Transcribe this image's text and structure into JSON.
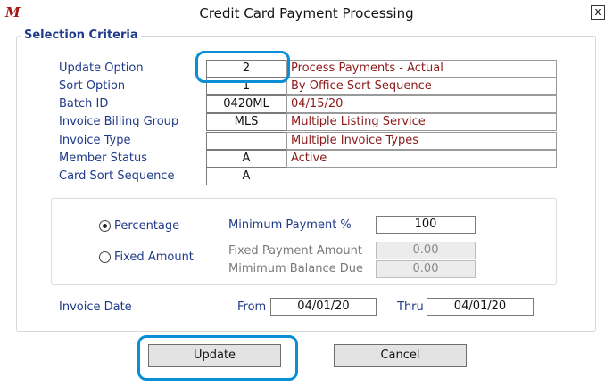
{
  "window": {
    "title": "Credit Card Payment Processing",
    "close_glyph": "x",
    "app_icon_glyph": "M"
  },
  "selection": {
    "title": "Selection Criteria",
    "update_option": {
      "label": "Update Option",
      "value": "2",
      "desc": "Process Payments - Actual"
    },
    "sort_option": {
      "label": "Sort Option",
      "value": "1",
      "desc": "By Office Sort Sequence"
    },
    "batch_id": {
      "label": "Batch ID",
      "value": "0420ML",
      "desc": "04/15/20"
    },
    "billing_group": {
      "label": "Invoice Billing Group",
      "value": "MLS",
      "desc": "Multiple Listing Service"
    },
    "invoice_type": {
      "label": "Invoice Type",
      "value": "",
      "desc": "Multiple Invoice Types"
    },
    "member_status": {
      "label": "Member Status",
      "value": "A",
      "desc": "Active"
    },
    "card_sort": {
      "label": "Card Sort Sequence",
      "value": "A"
    }
  },
  "payment": {
    "percentage_label": "Percentage",
    "fixed_label": "Fixed Amount",
    "selected": "percentage",
    "min_payment_label": "Minimum Payment %",
    "min_payment_value": "100",
    "fixed_amount_label": "Fixed Payment Amount",
    "fixed_amount_value": "0.00",
    "min_balance_label": "Mimimum Balance Due",
    "min_balance_value": "0.00"
  },
  "invoice_date": {
    "label": "Invoice Date",
    "from_label": "From",
    "from_value": "04/01/20",
    "thru_label": "Thru",
    "thru_value": "04/01/20"
  },
  "buttons": {
    "update": "Update",
    "cancel": "Cancel"
  },
  "colors": {
    "label": "#1f3a8a",
    "description": "#8b1a1a",
    "highlight": "#0a8fd6"
  }
}
